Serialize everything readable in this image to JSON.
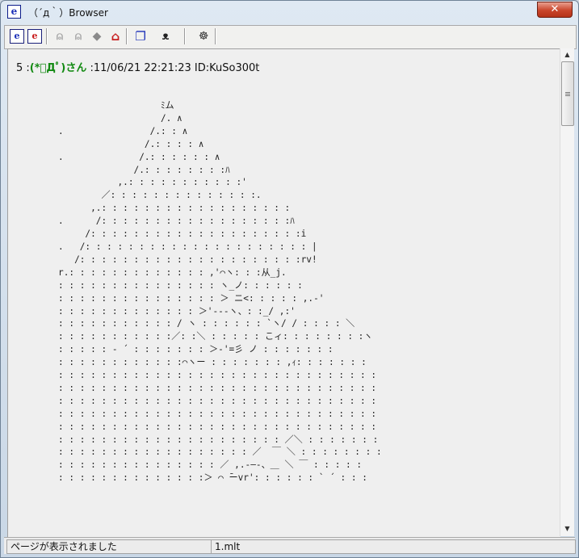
{
  "window": {
    "title": "（´д｀）Browser",
    "app_icon": "e",
    "close_label": "✕"
  },
  "toolbar": {
    "buttons": [
      {
        "name": "ie-button-1",
        "icon": "e"
      },
      {
        "name": "ie-button-2",
        "icon": "e"
      },
      {
        "name": "back-button",
        "icon": "back-cat-icon"
      },
      {
        "name": "forward-button",
        "icon": "forward-cat-icon"
      },
      {
        "name": "stop-button",
        "icon": "stop-icon"
      },
      {
        "name": "home-button",
        "icon": "home-icon"
      },
      {
        "name": "windows-button",
        "icon": "windows-icon"
      },
      {
        "name": "cat-button",
        "icon": "cat-face-icon"
      },
      {
        "name": "settings-button",
        "icon": "cat-gear-icon"
      }
    ],
    "icon_text": {
      "e1": "e",
      "e2": "e",
      "back": "⍝",
      "forward": "⍝",
      "stop": "◆",
      "home": "⌂",
      "windows": "❐",
      "cat": "ᴥ",
      "gear": "☸"
    }
  },
  "post": {
    "number": "5",
    "sep": " :",
    "name": "(*ﾟДﾟ)さん",
    "date": " :11/06/21 22:21:23 ",
    "id": "ID:KuSo300t"
  },
  "ascii_art": "                      ﾐム\n                      /. ∧\n   .                /.: : ∧\n                   /.: : : : ∧\n   .              /.: : : : : : ∧\n                 /.: : : : : : : :ﾊ\n              ,.: : : : : : : : : : :'\n           ／: : : : : : : : : : : : : :.\n         ,.: : : : : : : : : : : : : : : : : :\n   .      /: : : : : : : : : : : : : : : : : :ﾊ\n        /: : : : : : : : : : : : : : : : : : : :i\n   .   /: : : : : : : : : : : : : : : : : : : : : |\n      /: : : : : : : : : : : : : : : : : : : : :rv!\n   r.: : : : : : : : : : : : : ,'⌒ヽ: : :从_j.\n   : : : : : : : : : : : : : : : ヽ_ノ: : : : : :\n   : : : : : : : : : : : : : : : ＞ ニ<: : : : : ,.-'\n   : : : : : : : : : : : : : ＞'‐-‐ヽ、: :_/ ,:'\n   : : : : : : : : : : : / ヽ : : : : : : `ヽ/ / : : : : ＼\n   : : : : : : : : : : :／: :＼ : : : : : こィ: : : : : : : :ヽ\n   : : : : : ‐ ´ : : : : : : : ＞-'=彡 ノ : : : : : : :\n   : : : : : : : : : : : :⌒ヽー : : : : : : : ,ｨ: : : : : : :\n   : : : : : : : : : : : : : : : : : : : : : : : : : : : : : :\n   : : : : : : : : : : : : : : : : : : : : : : : : : : : : : :\n   : : : : : : : : : : : : : : : : : : : : : : : : : : : : : :\n   : : : : : : : : : : : : : : : : : : : : : : : : : : : : : :\n   : : : : : : : : : : : : : : : : : : : : : : : : : : : : : :\n   : : : : : : : : : : : : : : : : : : : : : ／＼ : : : : : : :\n   : : : : : : : : : : : : : : : : : : ／  ￣ ＼ : : : : : : : :\n   : : : : : : : : : : : : : : : ／ ,.-―‐、＿ ＼ ￣ : : : : :\n   : : : : : : : : : : : : : :＞ ⌒ ̄ーvr': : : : : : ` ´ : : :",
  "status": {
    "message": "ページが表示されました",
    "file": "1.mlt"
  }
}
